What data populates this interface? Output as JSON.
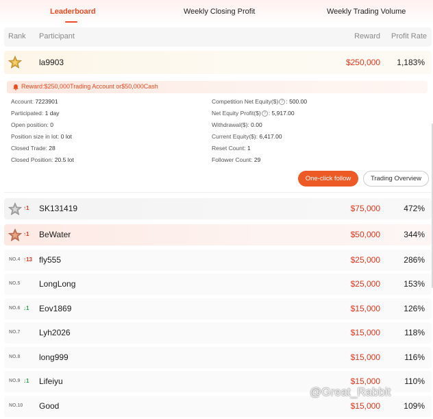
{
  "tabs": [
    {
      "label": "Leaderboard",
      "active": true
    },
    {
      "label": "Weekly Closing Profit",
      "active": false
    },
    {
      "label": "Weekly Trading Volume",
      "active": false
    }
  ],
  "table_header": {
    "rank": "Rank",
    "participant": "Participant",
    "reward": "Reward",
    "profit_rate": "Profit Rate"
  },
  "rows": [
    {
      "rank": 1,
      "rank_label": "",
      "medal": "gold-medal-icon",
      "change": "",
      "name": "la9903",
      "reward": "$250,000",
      "profit_rate": "1,183%"
    },
    {
      "rank": 2,
      "rank_label": "",
      "medal": "silver-medal-icon",
      "change": "1",
      "change_dir": "up",
      "name": "SK131419",
      "reward": "$75,000",
      "profit_rate": "472%"
    },
    {
      "rank": 3,
      "rank_label": "",
      "medal": "bronze-medal-icon",
      "change": "1",
      "change_dir": "up",
      "name": "BeWater",
      "reward": "$50,000",
      "profit_rate": "344%"
    },
    {
      "rank": 4,
      "rank_label": "NO.4",
      "change": "13",
      "change_dir": "up",
      "name": "fly555",
      "reward": "$25,000",
      "profit_rate": "286%"
    },
    {
      "rank": 5,
      "rank_label": "NO.5",
      "change": "",
      "name": "LongLong",
      "reward": "$25,000",
      "profit_rate": "153%"
    },
    {
      "rank": 6,
      "rank_label": "NO.6",
      "change": "1",
      "change_dir": "down",
      "name": "Eov1869",
      "reward": "$15,000",
      "profit_rate": "126%"
    },
    {
      "rank": 7,
      "rank_label": "NO.7",
      "change": "",
      "name": "Lyh2026",
      "reward": "$15,000",
      "profit_rate": "118%"
    },
    {
      "rank": 8,
      "rank_label": "NO.8",
      "change": "",
      "name": "long999",
      "reward": "$15,000",
      "profit_rate": "116%"
    },
    {
      "rank": 9,
      "rank_label": "NO.9",
      "change": "1",
      "change_dir": "down",
      "name": "Lifeiyu",
      "reward": "$15,000",
      "profit_rate": "110%"
    },
    {
      "rank": 10,
      "rank_label": "NO.10",
      "change": "",
      "name": "Good",
      "reward": "$15,000",
      "profit_rate": "109%"
    }
  ],
  "detail": {
    "reward_text": "Reward:$250,000Trading Account or$50,000Cash",
    "left": [
      {
        "label": "Account:",
        "value": "7223901"
      },
      {
        "label": "Participated:",
        "value": "1 day"
      },
      {
        "label": "Open position:",
        "value": "0"
      },
      {
        "label": "Position size in lot:",
        "value": "0 lot"
      },
      {
        "label": "Closed Trade:",
        "value": "28"
      },
      {
        "label": "Closed Position:",
        "value": "20.5 lot"
      }
    ],
    "right": [
      {
        "label": "Competition Net Equity($)",
        "help": "?",
        "value": "500.00"
      },
      {
        "label": "Net Equity Profit($)",
        "help": "?",
        "value": "5,917.00"
      },
      {
        "label": "Withdrawal($):",
        "value": "0.00"
      },
      {
        "label": "Current Equity($):",
        "value": "6,417.00"
      },
      {
        "label": "Reset Count:",
        "value": "1"
      },
      {
        "label": "Follower Count:",
        "value": "29"
      }
    ],
    "follow_button": "One-click follow",
    "overview_button": "Trading Overview"
  },
  "watermark": "@Great_Rabbit",
  "colors": {
    "accent": "#ec4a1f",
    "reward": "#e8351a",
    "up": "#e8351a",
    "down": "#24a148"
  }
}
